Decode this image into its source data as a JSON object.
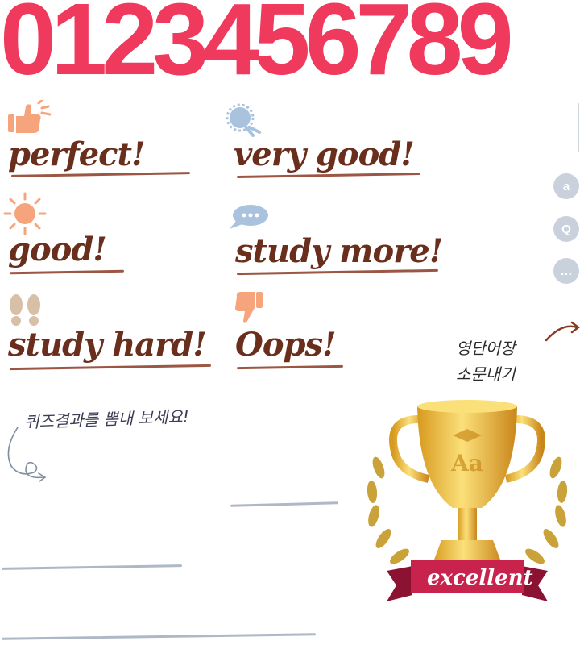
{
  "digits": "0123456789",
  "stamps": [
    {
      "text": "perfect!",
      "icon": "thumbs-up-icon"
    },
    {
      "text": "very good!",
      "icon": "star-badge-icon"
    },
    {
      "text": "good!",
      "icon": "sun-icon"
    },
    {
      "text": "study more!",
      "icon": "speech-bubble-icon"
    },
    {
      "text": "study hard!",
      "icon": "footprints-icon"
    },
    {
      "text": "Oops!",
      "icon": "thumbs-down-icon"
    }
  ],
  "share_caption": "영단어장\n소문내기",
  "quiz_caption": "퀴즈결과를 뽐내 보세요!",
  "side_buttons": [
    {
      "label": "a",
      "icon": "letter-a-icon"
    },
    {
      "label": "Q",
      "icon": "letter-q-icon"
    },
    {
      "label": "…",
      "icon": "chat-bubble-icon"
    }
  ],
  "trophy": {
    "emblem": "Aa",
    "ribbon": "excellent"
  },
  "colors": {
    "digits": "#ef3a5d",
    "ink": "#6a2e1c",
    "gold": "#e8b63a",
    "ribbon": "#c8234d"
  }
}
